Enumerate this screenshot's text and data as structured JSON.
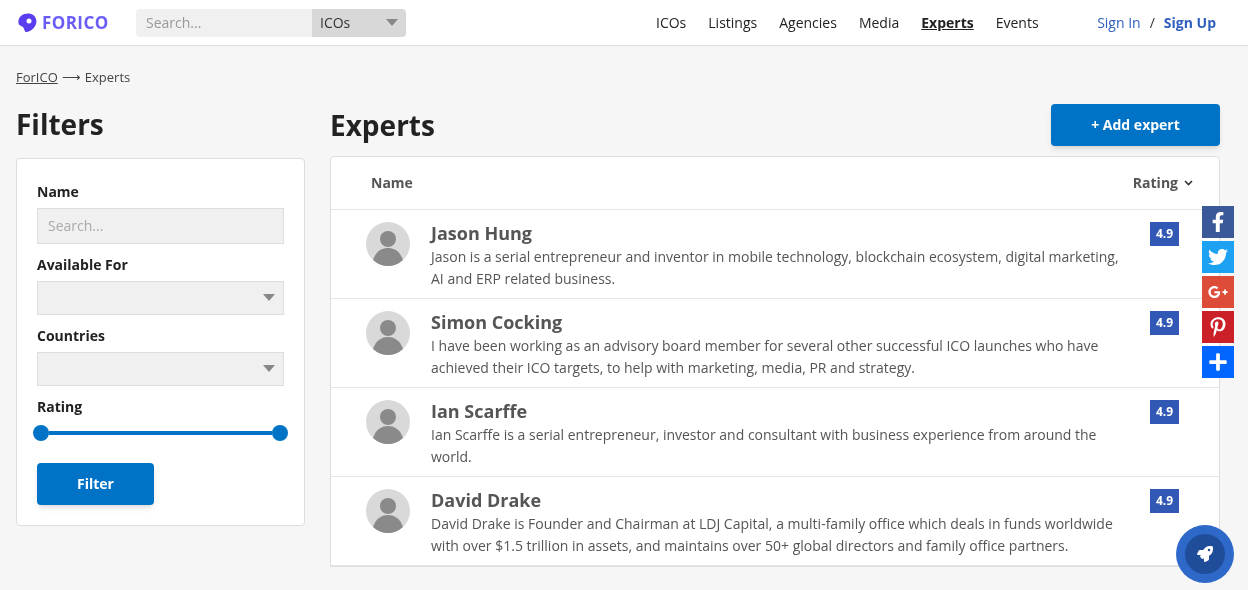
{
  "header": {
    "logo": "FORICO",
    "search": {
      "placeholder": "Search..."
    },
    "category": "ICOs",
    "nav": [
      {
        "label": "ICOs",
        "selected": false
      },
      {
        "label": "Listings",
        "selected": false
      },
      {
        "label": "Agencies",
        "selected": false
      },
      {
        "label": "Media",
        "selected": false
      },
      {
        "label": "Experts",
        "selected": true
      },
      {
        "label": "Events",
        "selected": false
      }
    ],
    "sign_in": "Sign In",
    "separator": "/",
    "sign_up": "Sign Up"
  },
  "breadcrumb": {
    "link": "ForICO",
    "arrow": "⟶",
    "current": "Experts"
  },
  "filters": {
    "title": "Filters",
    "name_label": "Name",
    "name_placeholder": "Search...",
    "available_label": "Available For",
    "countries_label": "Countries",
    "rating_label": "Rating",
    "rating_thumbs": [
      {
        "level": 0
      },
      {
        "level": 1
      }
    ],
    "button": "Filter"
  },
  "experts": {
    "title": "Experts",
    "add_button": "+ Add expert",
    "columns": {
      "name": "Name",
      "rating": "Rating"
    },
    "rows": [
      {
        "name": "Jason Hung",
        "bio": "Jason is a serial entrepreneur and inventor in mobile technology, blockchain ecosystem, digital marketing, AI and ERP related business.",
        "rating": "4.9"
      },
      {
        "name": "Simon Cocking",
        "bio": "I have been working as an advisory board member for several other successful ICO launches who have achieved their ICO targets, to help with marketing, media, PR and strategy.",
        "rating": "4.9"
      },
      {
        "name": "Ian Scarffe",
        "bio": "Ian Scarffe is a serial entrepreneur, investor and consultant with business experience from around the world.",
        "rating": "4.9"
      },
      {
        "name": "David Drake",
        "bio": "David Drake is Founder and Chairman at LDJ Capital, a multi-family office which deals in funds worldwide with over $1.5 trillion in assets, and maintains over 50+ global directors and family office partners.",
        "rating": "4.9"
      }
    ]
  }
}
